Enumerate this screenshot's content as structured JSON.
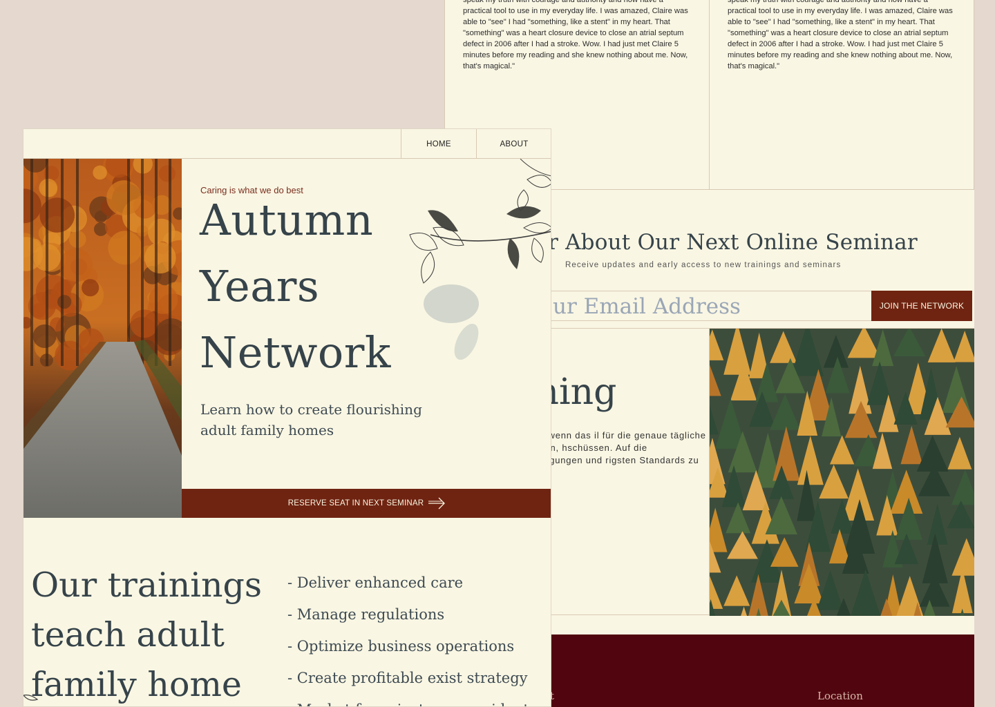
{
  "testimonials": [
    {
      "text": "speak my truth with courage and authority and now have a practical tool to use in my everyday life. I was amazed, Claire was able to \"see\" I had \"something, like a stent\" in my heart. That \"something\" was a heart closure device to close an atrial septum defect in 2006 after I had a stroke. Wow. I had just met Claire 5 minutes before my reading and she knew nothing about me. Now, that's magical.\""
    },
    {
      "text": "speak my truth with courage and authority and now have a practical tool to use in my everyday life. I was amazed, Claire was able to \"see\" I had \"something, like a stent\" in my heart. That \"something\" was a heart closure device to close an atrial septum defect in 2006 after I had a stroke. Wow. I had just met Claire 5 minutes before my reading and she knew nothing about me. Now, that's magical.\""
    }
  ],
  "seminar": {
    "title": "r About Our Next Online Seminar",
    "subtitle": "Receive updates and early access to new trainings and seminars",
    "email_placeholder": "ur Email Address",
    "join_label": "JOIN THE NETWORK"
  },
  "training": {
    "title": "raining",
    "text": "anzuwenden, wenn das il für die genaue tägliche Zusatzbeträgen, hschüssen. Auf die derheitsbeteiligungen und rigsten Standards zu"
  },
  "footer": {
    "contact": "ntact",
    "location": "Location"
  },
  "nav": {
    "home": "HOME",
    "about": "ABOUT"
  },
  "hero": {
    "tagline": "Caring is what we do best",
    "title_line1": "Autumn",
    "title_line2": "Years",
    "title_line3": "Network",
    "subtitle": "Learn how to create flourishing adult family homes",
    "cta_label": "RESERVE SEAT IN NEXT SEMINAR"
  },
  "trainings": {
    "heading": "Our trainings teach adult family home",
    "items": [
      "- Deliver enhanced care",
      "- Manage regulations",
      "- Optimize business operations",
      "- Create profitable exist strategy",
      "- Market for private pay residents"
    ]
  },
  "colors": {
    "page_background": "#e4d8cf",
    "cream": "#f9f6e3",
    "brand_rust": "#6f2411",
    "footer_maroon": "#51060f",
    "heading_slate": "#36434a"
  },
  "icons": [
    "arrow-right-icon",
    "leaf-branch-illustration",
    "small-leaf-icon"
  ]
}
